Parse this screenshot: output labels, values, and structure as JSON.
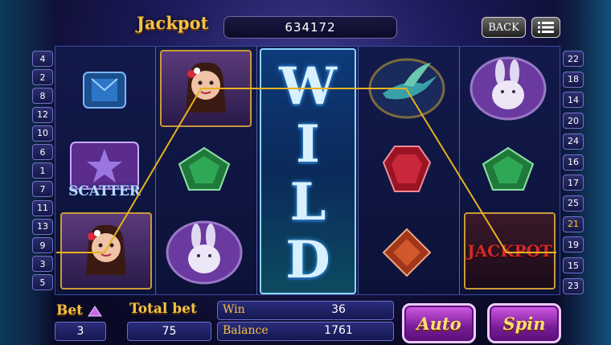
{
  "header": {
    "jackpot_label": "Jackpot",
    "jackpot_value": "634172",
    "back_label": "BACK"
  },
  "reels": {
    "scatter_label": "SCATTER",
    "wild_label": "WILD",
    "jackpot_symbol_label": "JACKPOT"
  },
  "left_lines": [
    "4",
    "2",
    "8",
    "12",
    "10",
    "6",
    "1",
    "7",
    "11",
    "13",
    "9",
    "3",
    "5"
  ],
  "right_lines": [
    "22",
    "18",
    "14",
    "20",
    "24",
    "16",
    "17",
    "25",
    "21",
    "19",
    "15",
    "23"
  ],
  "right_highlight": "21",
  "bottom": {
    "bet_label": "Bet",
    "bet_value": "3",
    "total_bet_label": "Total bet",
    "total_bet_value": "75",
    "win_label": "Win",
    "win_value": "36",
    "balance_label": "Balance",
    "balance_value": "1761",
    "auto_label": "Auto",
    "spin_label": "Spin"
  },
  "colors": {
    "gold": "#f5c242",
    "payline": "#e6b21f",
    "reel_bg": "#0c1238"
  }
}
